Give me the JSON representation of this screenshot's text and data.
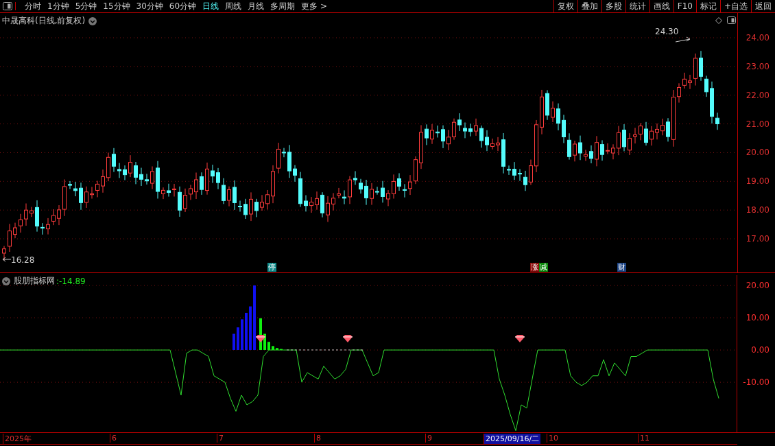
{
  "toolbar": {
    "periods": [
      {
        "label": "分时",
        "selected": false
      },
      {
        "label": "1分钟",
        "selected": false
      },
      {
        "label": "5分钟",
        "selected": false
      },
      {
        "label": "15分钟",
        "selected": false
      },
      {
        "label": "30分钟",
        "selected": false
      },
      {
        "label": "60分钟",
        "selected": false
      },
      {
        "label": "日线",
        "selected": true
      },
      {
        "label": "周线",
        "selected": false
      },
      {
        "label": "月线",
        "selected": false
      },
      {
        "label": "多周期",
        "selected": false
      },
      {
        "label": "更多 >",
        "selected": false
      }
    ],
    "actions": [
      "复权",
      "叠加",
      "多股",
      "统计",
      "画线",
      "F10",
      "标记",
      "+自选",
      "返回"
    ]
  },
  "chart": {
    "title": "中晟高科(日线,前复权)",
    "high_label": "24.30",
    "low_label": "16.28",
    "y_ticks": [
      "24.00",
      "23.00",
      "22.00",
      "21.00",
      "20.00",
      "19.00",
      "18.00",
      "17.00"
    ],
    "events": [
      {
        "label": "停",
        "color": "#108a8a"
      },
      {
        "label": "涨",
        "color": "#8a0c0c"
      },
      {
        "label": "减",
        "color": "#0c8a0c"
      },
      {
        "label": "财",
        "color": "#1c4484"
      }
    ]
  },
  "indicator": {
    "name": "股朋指标网",
    "value": ":-14.89",
    "chart_data": {
      "type": "line",
      "ylim": [
        -25.5,
        23.2
      ],
      "grid": true,
      "series": [
        {
          "color": "#30e030",
          "values": [
            0,
            0,
            0,
            0,
            0,
            0,
            0,
            0,
            0,
            0,
            0,
            0,
            0,
            0,
            0,
            0,
            0,
            0,
            0,
            0,
            0,
            0,
            0,
            0,
            0,
            0,
            0,
            0,
            0,
            0,
            0,
            0,
            -7,
            -14,
            -1,
            0,
            0,
            -1,
            -2,
            -8,
            -9,
            -10,
            -15,
            -19,
            -14,
            -17,
            -16,
            -14,
            -2,
            0,
            0,
            0,
            0,
            0,
            0,
            -10,
            -7,
            -8,
            -9,
            -5,
            -7,
            -9,
            -8,
            -6,
            0,
            0,
            0,
            -4,
            -8,
            -7,
            0,
            0,
            0,
            0,
            0,
            0,
            0,
            0,
            0,
            0,
            0,
            0,
            0,
            0,
            0,
            0,
            0,
            0,
            0,
            0,
            0,
            -9,
            -14,
            -20,
            -25,
            -17,
            -18,
            -9,
            0,
            0,
            0,
            0,
            0,
            0,
            -8,
            -10,
            -11,
            -10,
            -8,
            -8,
            -3,
            -8,
            -4,
            -6,
            -8,
            -2,
            -2,
            -1,
            0,
            0,
            0,
            0,
            0,
            0,
            0,
            0,
            0,
            0,
            0,
            0,
            -9,
            -15
          ]
        }
      ],
      "yticks": [
        {
          "value": 20,
          "label": "20.00"
        },
        {
          "value": 10,
          "label": "10.00"
        },
        {
          "value": 0,
          "label": "0.00"
        },
        {
          "value": -10,
          "label": "-10.00"
        }
      ]
    }
  },
  "date_axis": [
    {
      "label": "2025年",
      "selected": false
    },
    {
      "label": "6",
      "selected": false
    },
    {
      "label": "7",
      "selected": false
    },
    {
      "label": "8",
      "selected": false
    },
    {
      "label": "9",
      "selected": false
    },
    {
      "label": "2025/09/16/二",
      "selected": true
    },
    {
      "label": "10",
      "selected": false
    },
    {
      "label": "11",
      "selected": false
    }
  ]
}
